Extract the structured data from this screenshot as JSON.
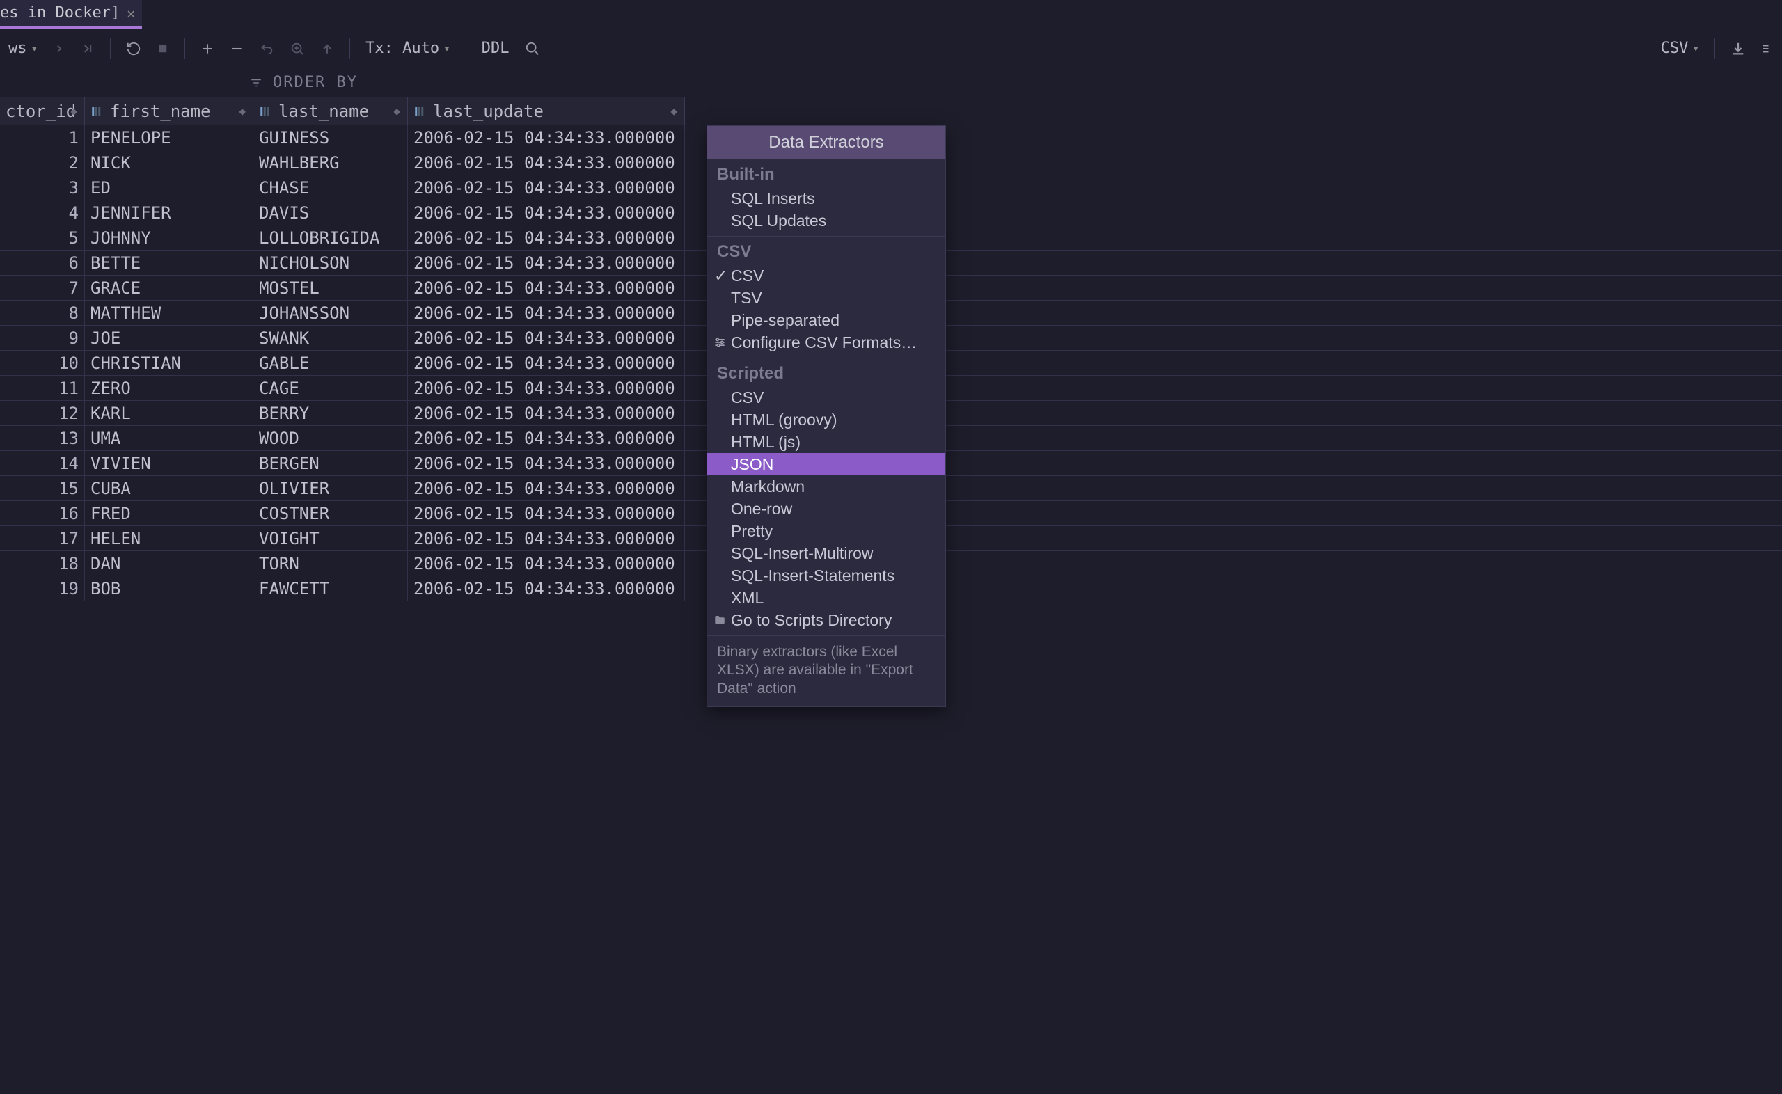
{
  "tab": {
    "title": "es in Docker]"
  },
  "toolbar": {
    "rows_label": "ws",
    "tx_label": "Tx: Auto",
    "ddl_label": "DDL",
    "export_label": "CSV"
  },
  "order_by_label": "ORDER BY",
  "columns": [
    "ctor_id",
    "first_name",
    "last_name",
    "last_update"
  ],
  "rows": [
    {
      "id": "1",
      "first": "PENELOPE",
      "last": "GUINESS",
      "upd": "2006-02-15 04:34:33.000000"
    },
    {
      "id": "2",
      "first": "NICK",
      "last": "WAHLBERG",
      "upd": "2006-02-15 04:34:33.000000"
    },
    {
      "id": "3",
      "first": "ED",
      "last": "CHASE",
      "upd": "2006-02-15 04:34:33.000000"
    },
    {
      "id": "4",
      "first": "JENNIFER",
      "last": "DAVIS",
      "upd": "2006-02-15 04:34:33.000000"
    },
    {
      "id": "5",
      "first": "JOHNNY",
      "last": "LOLLOBRIGIDA",
      "upd": "2006-02-15 04:34:33.000000"
    },
    {
      "id": "6",
      "first": "BETTE",
      "last": "NICHOLSON",
      "upd": "2006-02-15 04:34:33.000000"
    },
    {
      "id": "7",
      "first": "GRACE",
      "last": "MOSTEL",
      "upd": "2006-02-15 04:34:33.000000"
    },
    {
      "id": "8",
      "first": "MATTHEW",
      "last": "JOHANSSON",
      "upd": "2006-02-15 04:34:33.000000"
    },
    {
      "id": "9",
      "first": "JOE",
      "last": "SWANK",
      "upd": "2006-02-15 04:34:33.000000"
    },
    {
      "id": "10",
      "first": "CHRISTIAN",
      "last": "GABLE",
      "upd": "2006-02-15 04:34:33.000000"
    },
    {
      "id": "11",
      "first": "ZERO",
      "last": "CAGE",
      "upd": "2006-02-15 04:34:33.000000"
    },
    {
      "id": "12",
      "first": "KARL",
      "last": "BERRY",
      "upd": "2006-02-15 04:34:33.000000"
    },
    {
      "id": "13",
      "first": "UMA",
      "last": "WOOD",
      "upd": "2006-02-15 04:34:33.000000"
    },
    {
      "id": "14",
      "first": "VIVIEN",
      "last": "BERGEN",
      "upd": "2006-02-15 04:34:33.000000"
    },
    {
      "id": "15",
      "first": "CUBA",
      "last": "OLIVIER",
      "upd": "2006-02-15 04:34:33.000000"
    },
    {
      "id": "16",
      "first": "FRED",
      "last": "COSTNER",
      "upd": "2006-02-15 04:34:33.000000"
    },
    {
      "id": "17",
      "first": "HELEN",
      "last": "VOIGHT",
      "upd": "2006-02-15 04:34:33.000000"
    },
    {
      "id": "18",
      "first": "DAN",
      "last": "TORN",
      "upd": "2006-02-15 04:34:33.000000"
    },
    {
      "id": "19",
      "first": "BOB",
      "last": "FAWCETT",
      "upd": "2006-02-15 04:34:33.000000"
    }
  ],
  "popup": {
    "title": "Data Extractors",
    "groups": [
      {
        "label": "Built-in",
        "items": [
          {
            "label": "SQL Inserts"
          },
          {
            "label": "SQL Updates"
          }
        ]
      },
      {
        "label": "CSV",
        "items": [
          {
            "label": "CSV",
            "checked": true
          },
          {
            "label": "TSV"
          },
          {
            "label": "Pipe-separated"
          },
          {
            "label": "Configure CSV Formats…",
            "icon": "settings"
          }
        ]
      },
      {
        "label": "Scripted",
        "items": [
          {
            "label": "CSV"
          },
          {
            "label": "HTML (groovy)"
          },
          {
            "label": "HTML (js)"
          },
          {
            "label": "JSON",
            "selected": true
          },
          {
            "label": "Markdown"
          },
          {
            "label": "One-row"
          },
          {
            "label": "Pretty"
          },
          {
            "label": "SQL-Insert-Multirow"
          },
          {
            "label": "SQL-Insert-Statements"
          },
          {
            "label": "XML"
          },
          {
            "label": "Go to Scripts Directory",
            "icon": "folder"
          }
        ]
      }
    ],
    "footer": "Binary extractors (like Excel XLSX) are available in \"Export Data\" action"
  }
}
